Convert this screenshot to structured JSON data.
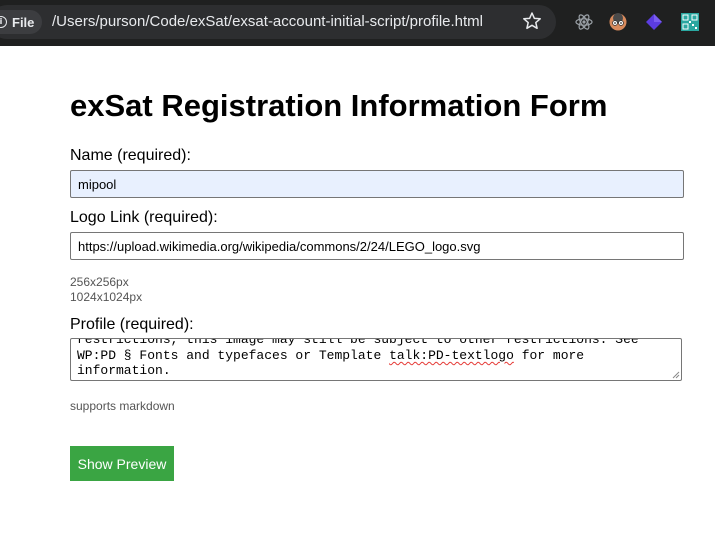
{
  "browser": {
    "site_chip_label": "File",
    "url": "/Users/purson/Code/exSat/exsat-account-initial-script/profile.html",
    "extensions": [
      "react-devtools-icon",
      "avatar-extension-icon",
      "purple-cube-extension-icon",
      "qr-code-extension-icon"
    ]
  },
  "form": {
    "title": "exSat Registration Information Form",
    "name": {
      "label": "Name (required):",
      "value": "mipool"
    },
    "logo": {
      "label": "Logo Link (required):",
      "value": "https://upload.wikimedia.org/wikipedia/commons/2/24/LEGO_logo.svg",
      "size_hints": [
        "256x256px",
        "1024x1024px"
      ]
    },
    "profile": {
      "label": "Profile (required):",
      "lines": {
        "line1": "restrictions, this image may still be subject to other restrictions. See",
        "line2_before": "WP:PD § Fonts and typefaces or Template ",
        "line2_marked": "talk:PD-textlogo",
        "line2_after": " for more",
        "line3": "information."
      },
      "hint": "supports markdown"
    },
    "preview_button": "Show Preview"
  },
  "colors": {
    "chrome_bg": "#1f2020",
    "autofill_bg": "#e8f0fe",
    "button_green": "#3aa543"
  }
}
